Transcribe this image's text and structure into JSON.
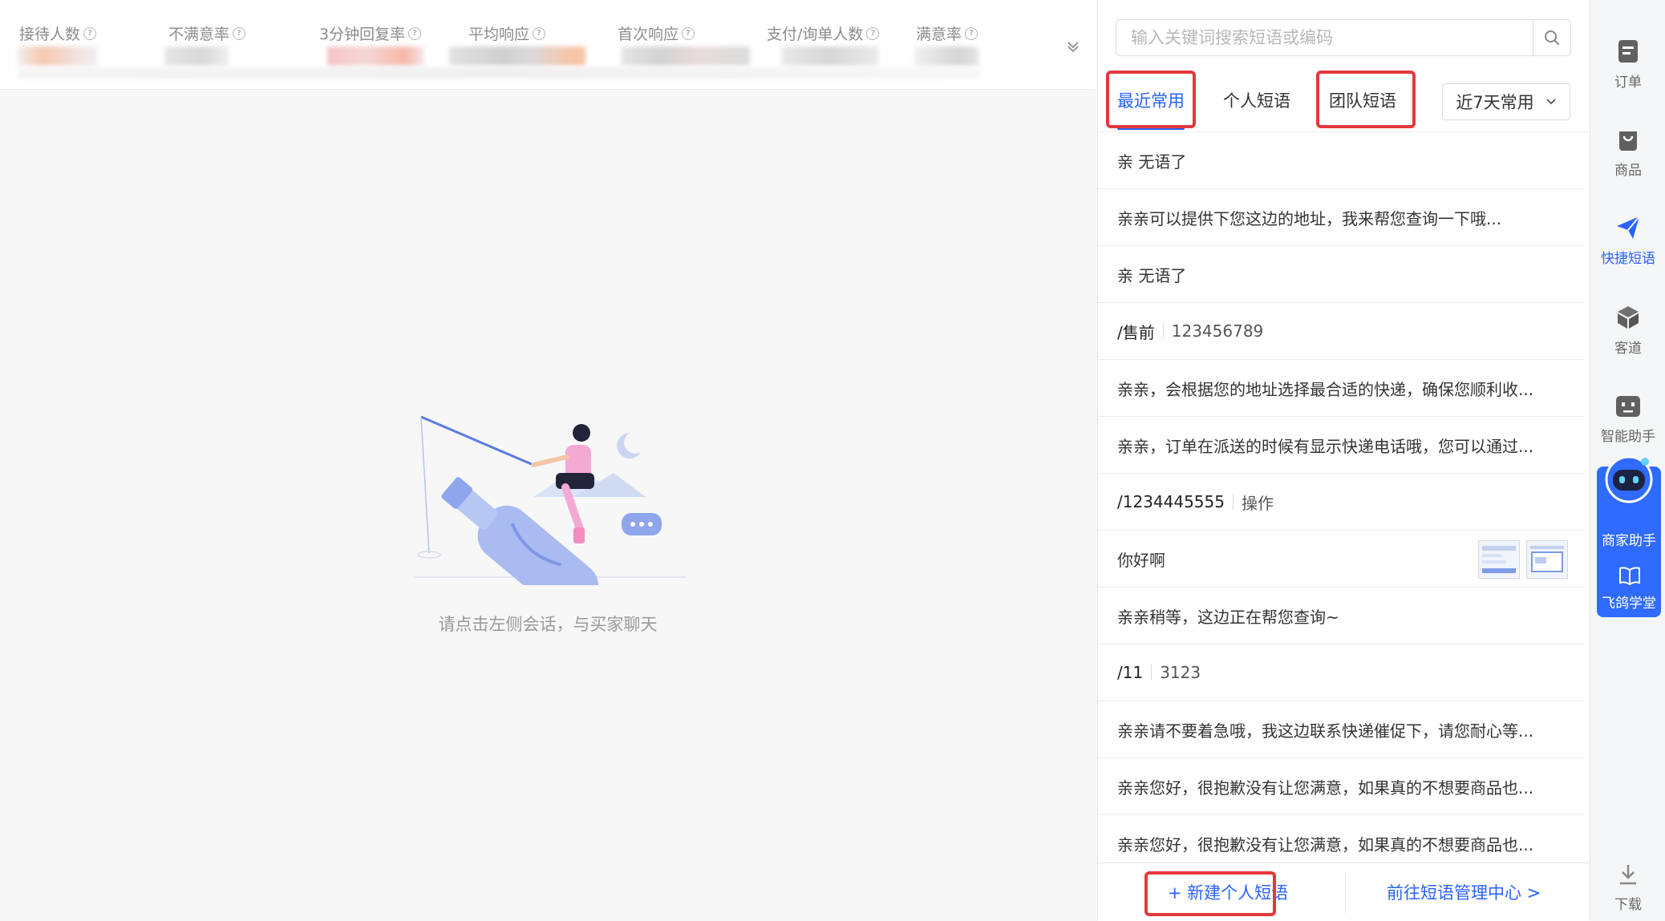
{
  "stats": {
    "items": [
      {
        "label": "接待人数"
      },
      {
        "label": "不满意率"
      },
      {
        "label": "3分钟回复率"
      },
      {
        "label": "平均响应"
      },
      {
        "label": "首次响应"
      },
      {
        "label": "支付/询单人数"
      },
      {
        "label": "满意率"
      }
    ],
    "help_icon": "help-circle-icon",
    "expand_icon": "chevron-double-down-icon"
  },
  "chat": {
    "empty_text": "请点击左侧会话，与买家聊天",
    "illustration_icon": "fishing-person-illustration"
  },
  "panel": {
    "search_placeholder": "输入关键词搜索短语或编码",
    "search_icon": "search-icon",
    "tabs": [
      {
        "label": "最近常用",
        "active": true
      },
      {
        "label": "个人短语",
        "active": false
      },
      {
        "label": "团队短语",
        "active": false
      }
    ],
    "range_select": "近7天常用",
    "phrases": [
      {
        "text": "亲 无语了"
      },
      {
        "text": "亲亲可以提供下您这边的地址，我来帮您查询一下哦..."
      },
      {
        "text": "亲 无语了"
      },
      {
        "key": "/售前",
        "value": "123456789"
      },
      {
        "text": "亲亲，会根据您的地址选择最合适的快递，确保您顺利收..."
      },
      {
        "text": "亲亲，订单在派送的时候有显示快递电话哦，您可以通过..."
      },
      {
        "key": "/1234445555",
        "value": "操作"
      },
      {
        "text": "你好啊"
      },
      {
        "text": "亲亲稍等，这边正在帮您查询~"
      },
      {
        "key": "/11",
        "value": "3123"
      },
      {
        "text": "亲亲请不要着急哦，我这边联系快递催促下，请您耐心等..."
      },
      {
        "text": "亲亲您好，很抱歉没有让您满意，如果真的不想要商品也..."
      },
      {
        "text": "亲亲您好，很抱歉没有让您满意，如果真的不想要商品也..."
      }
    ],
    "new_phrase": "+ 新建个人短语",
    "manage_center": "前往短语管理中心 >"
  },
  "toolbar": {
    "items": [
      {
        "label": "订单",
        "icon": "order-icon"
      },
      {
        "label": "商品",
        "icon": "product-bag-icon"
      },
      {
        "label": "快捷短语",
        "icon": "paper-plane-icon",
        "active": true
      },
      {
        "label": "客道",
        "icon": "cube-icon"
      },
      {
        "label": "智能助手",
        "icon": "robot-face-icon"
      }
    ],
    "assistant": "商家助手",
    "academy": "飞鸽学堂",
    "download": "下载",
    "accent": "#2962ff",
    "highlight": "#e5373d"
  }
}
